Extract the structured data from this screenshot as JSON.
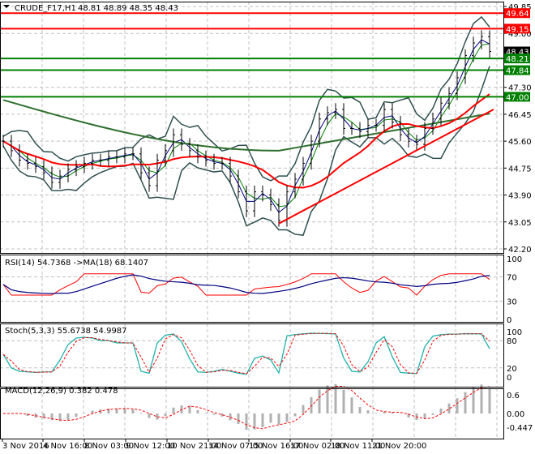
{
  "header": {
    "symbol": "CRUDE_F17,H1",
    "ohlc": "48.81 48.89 48.35 48.43"
  },
  "colors": {
    "bg": "#ffffff",
    "up": "#000000",
    "red": "#ff0000",
    "green": "#008000",
    "darkgreen": "#2f6f2f",
    "band": "#2f4f4f",
    "blue": "#000080",
    "teal": "#20b2aa",
    "hist": "#b0b0b0"
  },
  "chart_data": {
    "type": "line",
    "title": "CRUDE_F17,H1",
    "ylim": [
      42.2,
      49.85
    ],
    "y_ticks": [
      "49.85",
      "49.00",
      "47.30",
      "46.45",
      "45.60",
      "44.75",
      "43.90",
      "43.05",
      "42.20"
    ],
    "x_ticks": [
      "3 Nov 2016",
      "4 Nov 16:00",
      "8 Nov 03:00",
      "9 Nov 12:00",
      "10 Nov 21:00",
      "14 Nov 07:00",
      "15 Nov 16:00",
      "17 Nov 02:00",
      "18 Nov 11:00",
      "21 Nov 20:00"
    ],
    "close": [
      45.6,
      45.3,
      45.0,
      44.9,
      44.8,
      44.6,
      44.3,
      44.5,
      44.7,
      44.8,
      44.9,
      45.0,
      45.0,
      45.1,
      45.1,
      45.2,
      45.2,
      44.6,
      44.2,
      45.0,
      45.3,
      45.8,
      45.5,
      45.3,
      45.1,
      45.0,
      44.9,
      44.9,
      44.5,
      44.0,
      43.4,
      44.0,
      43.9,
      43.6,
      43.1,
      44.0,
      44.4,
      44.9,
      45.6,
      46.3,
      46.5,
      46.6,
      46.0,
      46.0,
      45.9,
      46.1,
      46.1,
      46.6,
      46.2,
      45.8,
      45.6,
      45.5,
      46.0,
      46.3,
      46.8,
      47.1,
      47.6,
      48.3,
      48.7,
      48.9,
      48.43
    ],
    "levels": [
      {
        "label": "49.64",
        "value": 49.64,
        "color": "red"
      },
      {
        "label": "49.15",
        "value": 49.15,
        "color": "red"
      },
      {
        "label": "48.43",
        "value": 48.43,
        "color": "black"
      },
      {
        "label": "48.21",
        "value": 48.21,
        "color": "green"
      },
      {
        "label": "47.84",
        "value": 47.84,
        "color": "green"
      },
      {
        "label": "47.00",
        "value": 47.0,
        "color": "green"
      }
    ],
    "trendline": {
      "from": [
        34,
        43.0
      ],
      "to": [
        60.5,
        46.6
      ]
    }
  },
  "rsi": {
    "label": "RSI(14) 54.7368  ->MA(18) 68.1407",
    "ticks": [
      "100",
      "70",
      "30",
      "0"
    ]
  },
  "stoch": {
    "label": "Stoch(5,3,3) 55.6738 54.9987",
    "ticks": [
      "100",
      "80",
      "20",
      "0"
    ]
  },
  "macd": {
    "label": "MACD(12,26,9) 0.382 0.478",
    "ticks": [
      "0.6",
      "0.00",
      "-0.447"
    ]
  }
}
